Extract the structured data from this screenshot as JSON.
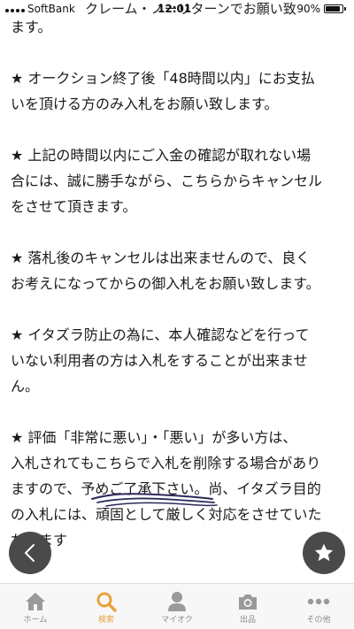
{
  "status_bar": {
    "carrier": "SoftBank",
    "time": "12:01",
    "battery_level": 0.9,
    "battery_text": "90%"
  },
  "header_text": "クレーム・ノーリターンでお願い致",
  "paragraphs": [
    "ます。",
    "★ オークション終了後「48時間以内」にお支払\nいを頂ける方のみ入札をお願い致します。",
    "★ 上記の時間以内にご入金の確認が取れない場\n合には、誠に勝手ながら、こちらからキャンセル\nをさせて頂きます。",
    "★ 落札後のキャンセルは出来ませんので、良く\nお考えになってからの御入札をお願い致します。",
    "★ イタズラ防止の為に、本人確認などを行って\nいない利用者の方は入札をすることが出来ませ\nん。",
    "★ 評価「非常に悪い」・「悪い」が多い方は、\n入札されてもこちらで入札を削除する場合があり\nますので、予めご了承下さい。尚、イタズラ目的\nの入札には、頑固として厳しく対応をさせていた\nだきます"
  ],
  "tabs": [
    {
      "label": "ホーム",
      "icon": "home-icon",
      "active": false
    },
    {
      "label": "検索",
      "icon": "search-icon",
      "active": true
    },
    {
      "label": "マイオク",
      "icon": "person-icon",
      "active": false
    },
    {
      "label": "出品",
      "icon": "camera-icon",
      "active": false
    },
    {
      "label": "その他",
      "icon": "more-icon",
      "active": false
    }
  ],
  "colors": {
    "accent": "#e8a33b",
    "icon_gray": "#9a9a9a",
    "fab_bg": "#4a4a4a"
  }
}
